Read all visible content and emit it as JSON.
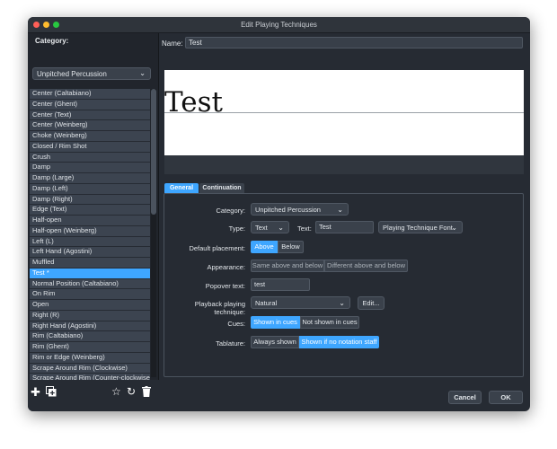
{
  "window": {
    "title": "Edit Playing Techniques"
  },
  "left": {
    "category_label": "Category:",
    "category_value": "Unpitched Percussion",
    "items": [
      "Center (Caltabiano)",
      "Center (Ghent)",
      "Center (Text)",
      "Center (Weinberg)",
      "Choke (Weinberg)",
      "Closed / Rim Shot",
      "Crush",
      "Damp",
      "Damp (Large)",
      "Damp (Left)",
      "Damp (Right)",
      "Edge (Text)",
      "Half-open",
      "Half-open (Weinberg)",
      "Left (L)",
      "Left Hand (Agostini)",
      "Muffled",
      "Test *",
      "Normal Position (Caltabiano)",
      "On Rim",
      "Open",
      "Right (R)",
      "Right Hand (Agostini)",
      "Rim (Caltabiano)",
      "Rim (Ghent)",
      "Rim or Edge (Weinberg)",
      "Scrape Around Rim (Clockwise)",
      "Scrape Around Rim (Counter-clockwise)"
    ],
    "selected_index": 17,
    "toolbar": {
      "add_icon": "plus-icon",
      "duplicate_icon": "duplicate-icon",
      "star_icon": "star-icon",
      "reset_icon": "reset-icon",
      "delete_icon": "trash-icon"
    }
  },
  "name": {
    "label": "Name:",
    "value": "Test"
  },
  "preview": {
    "text": "Test"
  },
  "tabs": [
    {
      "label": "General",
      "active": true
    },
    {
      "label": "Continuation",
      "active": false
    }
  ],
  "general": {
    "category": {
      "label": "Category:",
      "value": "Unpitched Percussion"
    },
    "type": {
      "label": "Type:",
      "value": "Text"
    },
    "text": {
      "label": "Text:",
      "value": "Test"
    },
    "font": {
      "value": "Playing Technique Font"
    },
    "default_placement": {
      "label": "Default placement:",
      "options": [
        "Above",
        "Below"
      ],
      "selected": "Above"
    },
    "appearance": {
      "label": "Appearance:",
      "options": [
        "Same above and below",
        "Different above and below"
      ]
    },
    "popover": {
      "label": "Popover text:",
      "value": "test"
    },
    "playback": {
      "label": "Playback playing technique:",
      "value": "Natural",
      "edit_button": "Edit..."
    },
    "cues": {
      "label": "Cues:",
      "options": [
        "Shown in cues",
        "Not shown in cues"
      ],
      "selected": "Shown in cues"
    },
    "tablature": {
      "label": "Tablature:",
      "options": [
        "Always shown",
        "Shown if no notation staff"
      ],
      "selected": "Shown if no notation staff"
    }
  },
  "footer": {
    "cancel": "Cancel",
    "ok": "OK"
  },
  "colors": {
    "accent": "#3ea6ff",
    "window_bg": "#262b33",
    "list_item": "#3c4450"
  }
}
